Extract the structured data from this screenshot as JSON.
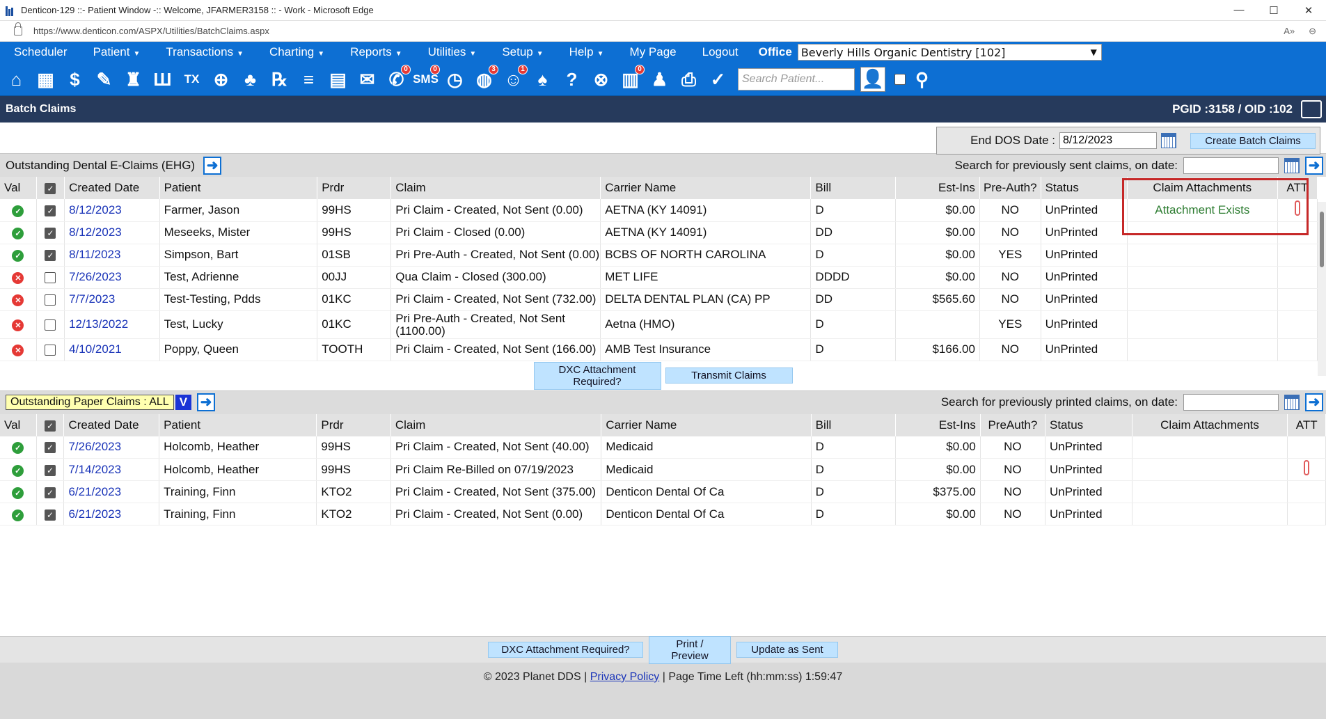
{
  "window": {
    "title": "Denticon-129 ::- Patient Window -:: Welcome, JFARMER3158 :: - Work - Microsoft Edge",
    "controls": [
      "—",
      "☐",
      "✕"
    ]
  },
  "address": {
    "url": "https://www.denticon.com/ASPX/Utilities/BatchClaims.aspx",
    "read_aloud": "A»",
    "zoom": "⊖"
  },
  "menu": {
    "items": [
      "Scheduler",
      "Patient",
      "Transactions",
      "Charting",
      "Reports",
      "Utilities",
      "Setup",
      "Help",
      "My Page",
      "Logout"
    ],
    "carets": [
      false,
      true,
      true,
      true,
      true,
      true,
      true,
      true,
      false,
      false
    ],
    "office_label": "Office",
    "office_value": "Beverly Hills Organic Dentistry [102]"
  },
  "toolbar": {
    "icons": [
      {
        "name": "home-icon",
        "glyph": "⌂",
        "badge": ""
      },
      {
        "name": "calendar-icon",
        "glyph": "▦",
        "badge": ""
      },
      {
        "name": "dollar-icon",
        "glyph": "$",
        "badge": ""
      },
      {
        "name": "edit-icon",
        "glyph": "✎",
        "badge": ""
      },
      {
        "name": "tooth-chart-icon",
        "glyph": "♜",
        "badge": ""
      },
      {
        "name": "perio-icon",
        "glyph": "Ш",
        "badge": ""
      },
      {
        "name": "tx-icon",
        "glyph": "TX",
        "badge": ""
      },
      {
        "name": "add-patient-icon",
        "glyph": "⊕",
        "badge": ""
      },
      {
        "name": "family-icon",
        "glyph": "♣",
        "badge": ""
      },
      {
        "name": "rx-icon",
        "glyph": "℞",
        "badge": ""
      },
      {
        "name": "notes-icon",
        "glyph": "≡",
        "badge": ""
      },
      {
        "name": "document-icon",
        "glyph": "▤",
        "badge": ""
      },
      {
        "name": "mail-icon",
        "glyph": "✉",
        "badge": ""
      },
      {
        "name": "message-icon",
        "glyph": "✆",
        "badge": "0"
      },
      {
        "name": "sms-icon",
        "glyph": "SMS",
        "badge": "0"
      },
      {
        "name": "clock-icon",
        "glyph": "◷",
        "badge": ""
      },
      {
        "name": "globe-icon",
        "glyph": "◍",
        "badge": "3"
      },
      {
        "name": "support-icon",
        "glyph": "☺",
        "badge": "1"
      },
      {
        "name": "tooth-icon",
        "glyph": "♠",
        "badge": ""
      },
      {
        "name": "tooth-help-icon",
        "glyph": "?",
        "badge": ""
      },
      {
        "name": "web-icon",
        "glyph": "⊗",
        "badge": ""
      },
      {
        "name": "billing-icon",
        "glyph": "▥",
        "badge": "0"
      },
      {
        "name": "group-icon",
        "glyph": "♟",
        "badge": ""
      },
      {
        "name": "printer-icon",
        "glyph": "⎙",
        "badge": ""
      },
      {
        "name": "checklist-icon",
        "glyph": "✓",
        "badge": ""
      }
    ],
    "search_placeholder": "Search Patient...",
    "search_icon": "👤"
  },
  "page": {
    "title": "Batch Claims",
    "ids": "PGID :3158  /  OID :102"
  },
  "batch": {
    "end_dos_label": "End DOS Date :",
    "end_dos_value": "8/12/2023",
    "create_btn": "Create Batch Claims"
  },
  "ehg": {
    "title": "Outstanding Dental E-Claims (EHG)",
    "search_label": "Search for previously sent claims, on date:",
    "headers": [
      "Val",
      "",
      "Created Date",
      "Patient",
      "Prdr",
      "Claim",
      "Carrier Name",
      "Bill",
      "Est-Ins",
      "Pre-Auth?",
      "Status",
      "Claim Attachments",
      "ATT"
    ],
    "rows": [
      {
        "val": "ok",
        "checked": true,
        "date": "8/12/2023",
        "patient": "Farmer, Jason",
        "prdr": "99HS",
        "claim": "Pri Claim - Created, Not Sent (0.00)",
        "carrier": "AETNA (KY 14091)",
        "bill": "D",
        "est": "$0.00",
        "preauth": "NO",
        "status": "UnPrinted",
        "attach": "Attachment Exists",
        "att": true
      },
      {
        "val": "ok",
        "checked": true,
        "date": "8/12/2023",
        "patient": "Meseeks, Mister",
        "prdr": "99HS",
        "claim": "Pri Claim - Closed (0.00)",
        "carrier": "AETNA (KY 14091)",
        "bill": "DD",
        "est": "$0.00",
        "preauth": "NO",
        "status": "UnPrinted",
        "attach": "",
        "att": false
      },
      {
        "val": "ok",
        "checked": true,
        "date": "8/11/2023",
        "patient": "Simpson, Bart",
        "prdr": "01SB",
        "claim": "Pri Pre-Auth - Created, Not Sent (0.00)",
        "carrier": "BCBS OF NORTH CAROLINA",
        "bill": "D",
        "est": "$0.00",
        "preauth": "YES",
        "status": "UnPrinted",
        "attach": "",
        "att": false
      },
      {
        "val": "bad",
        "checked": false,
        "date": "7/26/2023",
        "patient": "Test, Adrienne",
        "prdr": "00JJ",
        "claim": "Qua Claim - Closed (300.00)",
        "carrier": "MET LIFE",
        "bill": "DDDD",
        "est": "$0.00",
        "preauth": "NO",
        "status": "UnPrinted",
        "attach": "",
        "att": false
      },
      {
        "val": "bad",
        "checked": false,
        "date": "7/7/2023",
        "patient": "Test-Testing, Pdds",
        "prdr": "01KC",
        "claim": "Pri Claim - Created, Not Sent (732.00)",
        "carrier": "DELTA DENTAL PLAN (CA) PP",
        "bill": "DD",
        "est": "$565.60",
        "preauth": "NO",
        "status": "UnPrinted",
        "attach": "",
        "att": false
      },
      {
        "val": "bad",
        "checked": false,
        "date": "12/13/2022",
        "patient": "Test, Lucky",
        "prdr": "01KC",
        "claim": "Pri Pre-Auth - Created, Not Sent (1100.00)",
        "carrier": "Aetna (HMO)",
        "bill": "D",
        "est": "",
        "preauth": "YES",
        "status": "UnPrinted",
        "attach": "",
        "att": false
      },
      {
        "val": "bad",
        "checked": false,
        "date": "4/10/2021",
        "patient": "Poppy, Queen",
        "prdr": "TOOTH",
        "claim": "Pri Claim - Created, Not Sent (166.00)",
        "carrier": "AMB Test Insurance",
        "bill": "D",
        "est": "$166.00",
        "preauth": "NO",
        "status": "UnPrinted",
        "attach": "",
        "att": false
      }
    ],
    "btn_dxc": "DXC Attachment Required?",
    "btn_transmit": "Transmit Claims"
  },
  "paper": {
    "title": "Outstanding Paper Claims : ALL",
    "v_label": "V",
    "search_label": "Search for previously printed claims, on date:",
    "headers": [
      "Val",
      "",
      "Created Date",
      "Patient",
      "Prdr",
      "Claim",
      "Carrier Name",
      "Bill",
      "Est-Ins",
      "PreAuth?",
      "Status",
      "Claim Attachments",
      "ATT"
    ],
    "rows": [
      {
        "val": "ok",
        "checked": true,
        "date": "7/26/2023",
        "patient": "Holcomb, Heather",
        "prdr": "99HS",
        "claim": "Pri Claim - Created, Not Sent (40.00)",
        "carrier": "Medicaid",
        "bill": "D",
        "est": "$0.00",
        "preauth": "NO",
        "status": "UnPrinted",
        "attach": "",
        "att": false
      },
      {
        "val": "ok",
        "checked": true,
        "date": "7/14/2023",
        "patient": "Holcomb, Heather",
        "prdr": "99HS",
        "claim": "Pri Claim Re-Billed on 07/19/2023",
        "carrier": "Medicaid",
        "bill": "D",
        "est": "$0.00",
        "preauth": "NO",
        "status": "UnPrinted",
        "attach": "",
        "att": true
      },
      {
        "val": "ok",
        "checked": true,
        "date": "6/21/2023",
        "patient": "Training, Finn",
        "prdr": "KTO2",
        "claim": "Pri Claim - Created, Not Sent (375.00)",
        "carrier": "Denticon Dental Of Ca",
        "bill": "D",
        "est": "$375.00",
        "preauth": "NO",
        "status": "UnPrinted",
        "attach": "",
        "att": false
      },
      {
        "val": "ok",
        "checked": true,
        "date": "6/21/2023",
        "patient": "Training, Finn",
        "prdr": "KTO2",
        "claim": "Pri Claim - Created, Not Sent (0.00)",
        "carrier": "Denticon Dental Of Ca",
        "bill": "D",
        "est": "$0.00",
        "preauth": "NO",
        "status": "UnPrinted",
        "attach": "",
        "att": false
      }
    ],
    "btn_dxc": "DXC Attachment Required?",
    "btn_print": "Print / Preview",
    "btn_update": "Update as Sent"
  },
  "footer": {
    "copyright": "© 2023 Planet DDS |",
    "privacy": "Privacy Policy",
    "sep": "|",
    "time_left": "Page Time Left (hh:mm:ss) 1:59:47"
  },
  "colors": {
    "menu_blue": "#0d6fd3",
    "title_navy": "#263a5c",
    "highlight_red": "#c62828",
    "attach_green": "#2e7d32"
  }
}
